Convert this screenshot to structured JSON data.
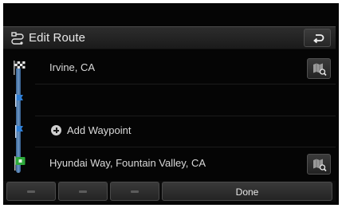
{
  "header": {
    "title": "Edit Route",
    "icon": "edit-route-icon",
    "back_icon": "back-arrow-icon"
  },
  "route": {
    "start": {
      "label": "Irvine, CA",
      "icon": "checkered-flag-icon"
    },
    "waypoints": [
      {
        "label": "",
        "icon": "waypoint-flag-icon"
      },
      {
        "label": "Add Waypoint",
        "icon": "add-circle-icon"
      }
    ],
    "destination": {
      "label": "Hyundai Way, Fountain Valley, CA",
      "icon": "destination-flag-icon"
    },
    "map_search_icon": "map-search-icon"
  },
  "bottom_bar": {
    "buttons": [
      {
        "name": "button-1",
        "label": ""
      },
      {
        "name": "button-2",
        "label": ""
      },
      {
        "name": "button-3",
        "label": ""
      }
    ],
    "done_label": "Done"
  },
  "colors": {
    "background": "#050505",
    "header": "#262626",
    "text": "#d9d9d9",
    "route_line": "#7fb0e6",
    "destination_flag": "#2eaa3c"
  }
}
